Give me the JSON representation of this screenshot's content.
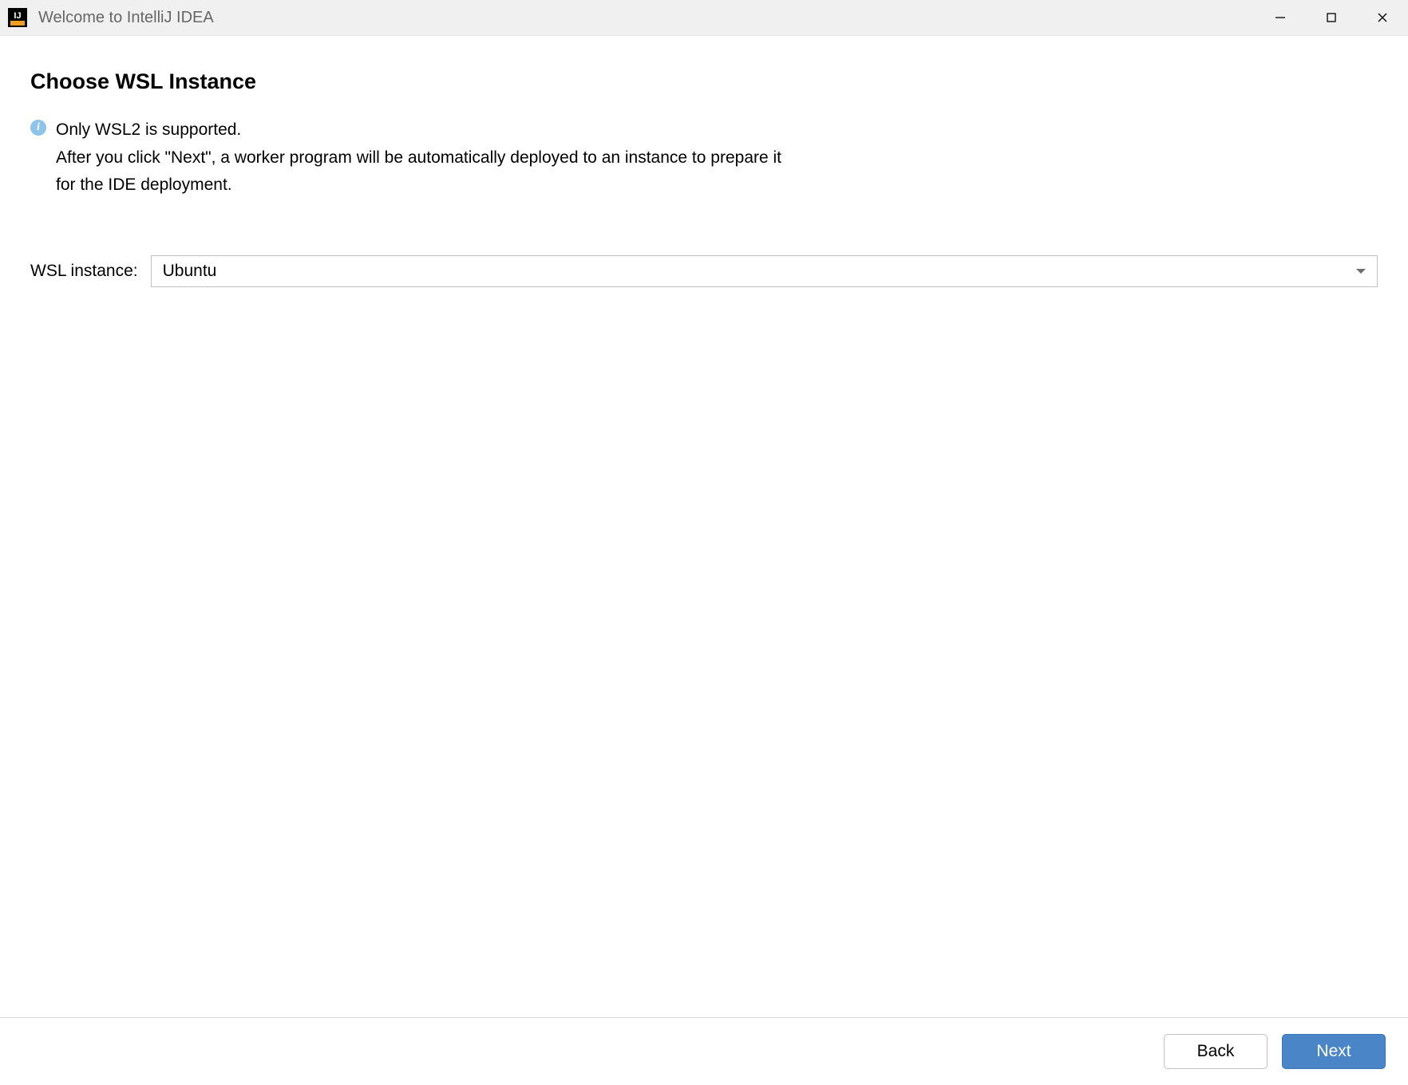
{
  "window": {
    "title": "Welcome to IntelliJ IDEA",
    "app_icon_text": "IJ"
  },
  "main": {
    "heading": "Choose WSL Instance",
    "info_line1": "Only WSL2 is supported.",
    "info_line2": "After you click \"Next\", a worker program will be automatically deployed to an instance to prepare it for the IDE deployment."
  },
  "form": {
    "wsl_instance_label": "WSL instance:",
    "wsl_instance_selected": "Ubuntu"
  },
  "footer": {
    "back_label": "Back",
    "next_label": "Next"
  }
}
